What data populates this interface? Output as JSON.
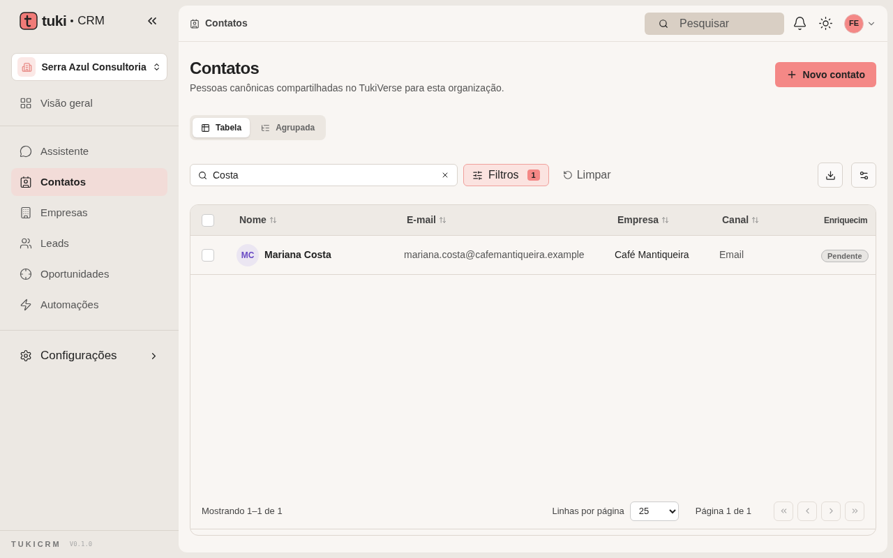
{
  "brand": {
    "name": "tuki",
    "suffix": "CRM"
  },
  "workspace": {
    "name": "Serra Azul Consultoria"
  },
  "nav_top": [
    {
      "label": "Visão geral",
      "selected": false
    }
  ],
  "nav": [
    {
      "label": "Assistente",
      "selected": false
    },
    {
      "label": "Contatos",
      "selected": true
    },
    {
      "label": "Empresas",
      "selected": false
    },
    {
      "label": "Leads",
      "selected": false
    },
    {
      "label": "Oportunidades",
      "selected": false
    },
    {
      "label": "Automações",
      "selected": false
    }
  ],
  "settings": {
    "label": "Configurações"
  },
  "footer": {
    "name": "TUKICRM",
    "version": "V0.1.0"
  },
  "breadcrumb": "Contatos",
  "search": {
    "placeholder": "Pesquisar"
  },
  "avatar": "FE",
  "page": {
    "title": "Contatos",
    "subtitle": "Pessoas canônicas compartilhadas no TukiVerse para esta organização.",
    "new_button": "Novo contato"
  },
  "views": [
    {
      "label": "Tabela",
      "selected": true
    },
    {
      "label": "Agrupada",
      "selected": false
    }
  ],
  "filter_bar": {
    "query": "Costa",
    "filters_label": "Filtros",
    "filters_count": "1",
    "clear_label": "Limpar"
  },
  "table": {
    "select_all_checked": false,
    "columns": [
      {
        "label": "Nome"
      },
      {
        "label": "E-mail"
      },
      {
        "label": "Empresa"
      },
      {
        "label": "Canal"
      },
      {
        "label": "Enriquecim"
      }
    ],
    "rows": [
      {
        "checked": false,
        "initials": "MC",
        "name": "Mariana Costa",
        "email": "mariana.costa@cafemantiqueira.example",
        "company": "Café Mantiqueira",
        "channel": "Email",
        "status": "Pendente"
      }
    ]
  },
  "pagination": {
    "summary": "Mostrando 1–1 de 1",
    "rows_label": "Linhas por página",
    "rows_value": "25",
    "page_label": "Página 1 de 1",
    "buttons": [
      {
        "disabled": true
      },
      {
        "disabled": true
      },
      {
        "disabled": true
      },
      {
        "disabled": true
      }
    ]
  }
}
